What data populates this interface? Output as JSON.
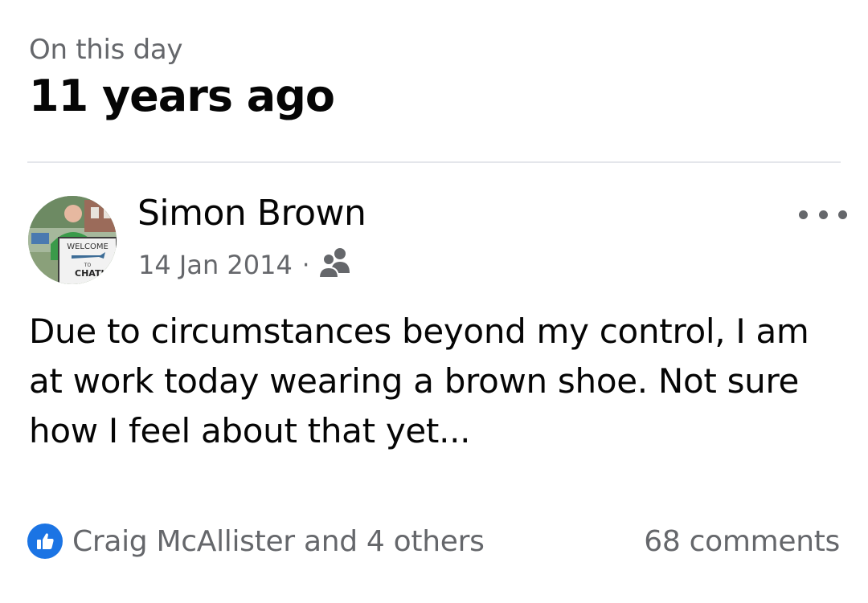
{
  "memory_header": {
    "subtitle": "On this day",
    "title": "11 years ago"
  },
  "post": {
    "author": "Simon Brown",
    "avatar_sign_text": {
      "line1": "WELCOME",
      "line2": "TO",
      "line3": "CHATHAM"
    },
    "date": "14 Jan 2014",
    "separator": "·",
    "audience_icon": "friends-icon",
    "more_icon": "more-dots-icon",
    "text": "Due to circumstances beyond my control, I am at work today wearing a brown shoe. Not sure how I feel about that yet...",
    "reactions_text": "Craig McAllister and 4 others",
    "reaction_icon": "like-icon",
    "comments_text": "68 comments"
  },
  "colors": {
    "primary_text": "#050505",
    "secondary_text": "#65676b",
    "divider": "#e4e6eb",
    "like_blue": "#1b74e4"
  }
}
